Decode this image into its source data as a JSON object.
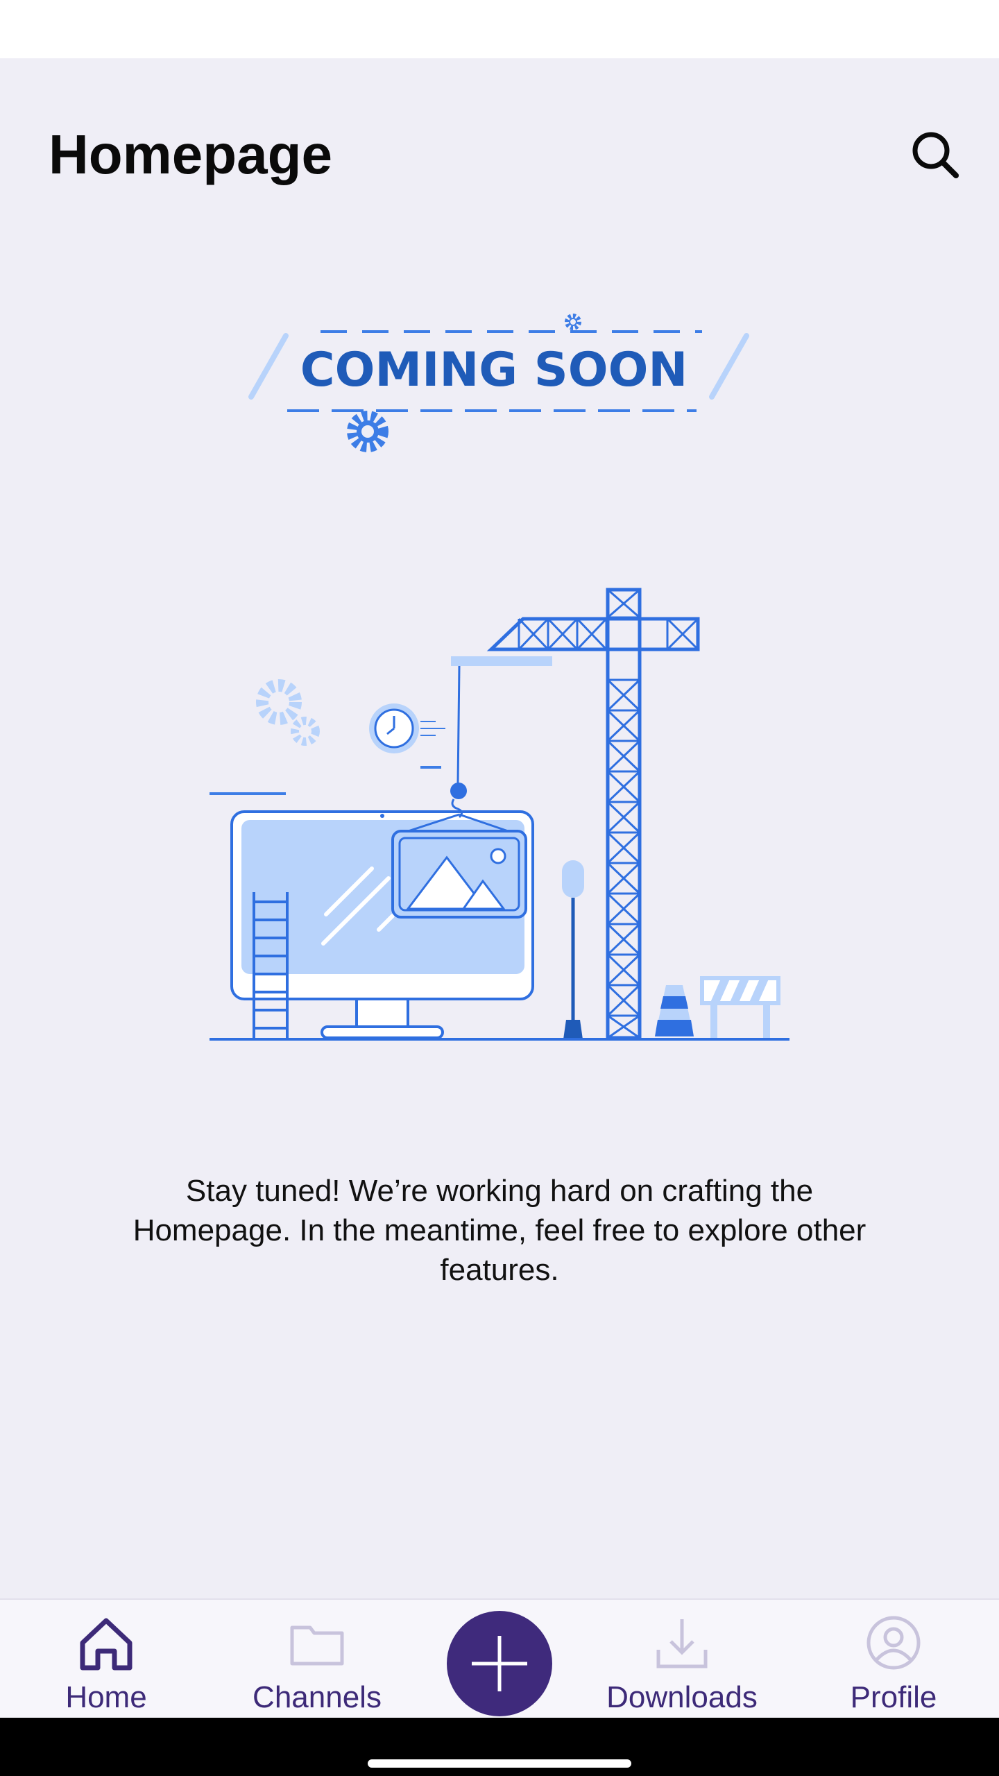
{
  "header": {
    "title": "Homepage",
    "search_icon": "search-icon"
  },
  "illustration": {
    "banner_text": "COMING SOON",
    "colors": {
      "primary": "#2f6fe0",
      "dark": "#1f5bb8",
      "light": "#b8d3fb",
      "line": "#3d7de6"
    }
  },
  "main": {
    "message": "Stay tuned! We’re working hard on crafting the Homepage. In the meantime, feel free to explore other features."
  },
  "bottom_nav": {
    "items": [
      {
        "label": "Home",
        "icon": "home-icon",
        "active": true
      },
      {
        "label": "Channels",
        "icon": "folder-icon",
        "active": false
      },
      {
        "label": "Downloads",
        "icon": "download-icon",
        "active": false
      },
      {
        "label": "Profile",
        "icon": "profile-icon",
        "active": false
      }
    ],
    "fab_icon": "plus-icon",
    "active_color": "#3d2a78",
    "inactive_icon_color": "#c8c3dc"
  }
}
